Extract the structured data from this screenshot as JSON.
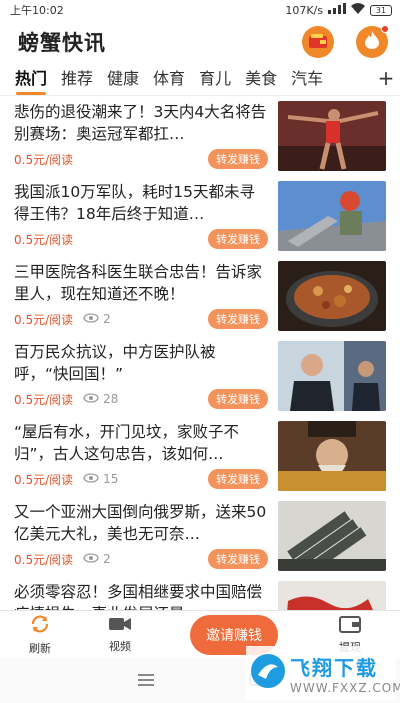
{
  "status_bar": {
    "time": "上午10:02",
    "speed": "107K/s",
    "battery": "31"
  },
  "header": {
    "title": "螃蟹快讯",
    "icons": [
      "wallet-icon",
      "flame-icon"
    ]
  },
  "tabs": [
    {
      "label": "热门"
    },
    {
      "label": "推荐"
    },
    {
      "label": "健康"
    },
    {
      "label": "体育"
    },
    {
      "label": "育儿"
    },
    {
      "label": "美食"
    },
    {
      "label": "汽车"
    }
  ],
  "tab_more": "+",
  "news": [
    {
      "title": "悲伤的退役潮来了！3天内4大名将告别赛场：奥运冠军都扛…",
      "price": "0.5元/阅读",
      "views": "",
      "action": "转发赚钱",
      "thumb": "athlete-photo"
    },
    {
      "title": "我国派10万军队，耗时15天都未寻得王伟？18年后终于知道…",
      "price": "0.5元/阅读",
      "views": "",
      "action": "转发赚钱",
      "thumb": "pilot-photo"
    },
    {
      "title": "三甲医院各科医生联合忠告！告诉家里人，现在知道还不晚！",
      "price": "0.5元/阅读",
      "views": "2",
      "action": "转发赚钱",
      "thumb": "fried-food-photo"
    },
    {
      "title": "百万民众抗议，中方医护队被呼，“快回国！”",
      "price": "0.5元/阅读",
      "views": "28",
      "action": "转发赚钱",
      "thumb": "news-anchor-photo"
    },
    {
      "title": "“屋后有水，开门见坟，家败子不归”，古人这句忠告，该如何…",
      "price": "0.5元/阅读",
      "views": "15",
      "action": "转发赚钱",
      "thumb": "emperor-photo"
    },
    {
      "title": "又一个亚洲大国倒向俄罗斯，送来50亿美元大礼，美也无可奈…",
      "price": "0.5元/阅读",
      "views": "2",
      "action": "转发赚钱",
      "thumb": "missile-photo"
    },
    {
      "title": "必须零容忍！多国相继要求中国赔偿疫情损失，事业发展还是",
      "price": "",
      "views": "",
      "action": "",
      "thumb": "map-photo"
    }
  ],
  "tabbar": {
    "refresh": "刷新",
    "video": "视频",
    "invite": "邀请赚钱",
    "withdraw": "提现"
  },
  "watermark": {
    "main": "飞翔下载",
    "sub": "WWW.FXXZ.COM"
  },
  "colors": {
    "accent": "#f0882a",
    "price": "#e2562f",
    "button": "#f3925a",
    "invite": "#ef6b3b"
  }
}
